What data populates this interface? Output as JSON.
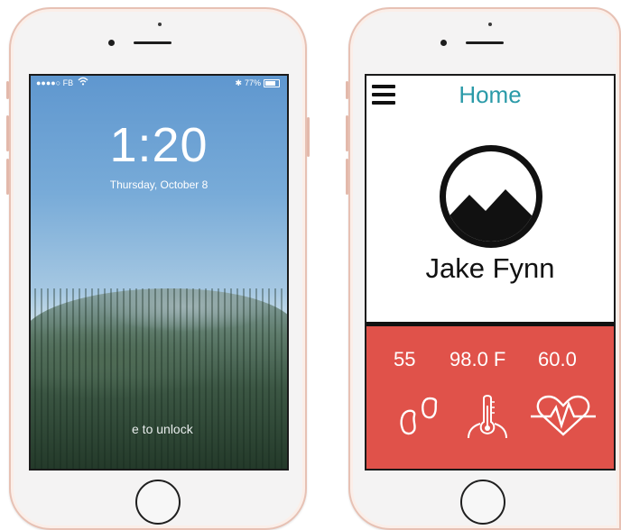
{
  "lock_screen": {
    "status": {
      "carrier": "●●●●○ FB",
      "battery": "77%"
    },
    "time": "1:20",
    "date": "Thursday, October 8",
    "unlock_hint": "e to unlock"
  },
  "app": {
    "title": "Home",
    "user_name": "Jake Fynn",
    "stats": [
      {
        "value": "55",
        "icon": "footprints-icon"
      },
      {
        "value": "98.0 F",
        "icon": "thermometer-icon"
      },
      {
        "value": "60.0",
        "icon": "heart-rate-icon"
      }
    ],
    "colors": {
      "accent": "#2a9aa8",
      "panel": "#e0524a",
      "frame": "#e7c1b4"
    }
  }
}
